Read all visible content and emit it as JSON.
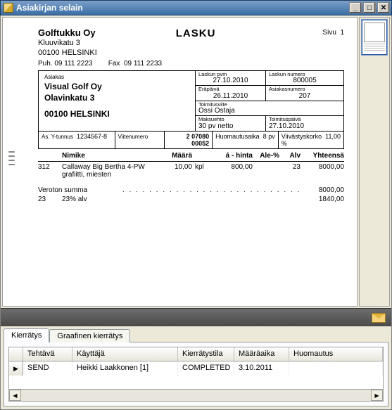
{
  "window": {
    "title": "Asiakirjan selain"
  },
  "invoice": {
    "company": {
      "name": "Golftukku Oy",
      "street": "Kluuvikatu 3",
      "city": "00100 HELSINKI",
      "phone_lbl": "Puh.",
      "phone": "09 111 2223",
      "fax_lbl": "Fax",
      "fax": "09 111 2233"
    },
    "doc_title": "LASKU",
    "page_lbl": "Sivu",
    "page_no": "1",
    "customer_lbl": "Asiakas",
    "customer": {
      "name": "Visual Golf Oy",
      "street": "Olavinkatu 3",
      "city": "00100 HELSINKI"
    },
    "info": {
      "laskun_pvm_lbl": "Laskun pvm",
      "laskun_pvm": "27.10.2010",
      "laskun_numero_lbl": "Laskun numero",
      "laskun_numero": "800005",
      "erapaiva_lbl": "Eräpäivä",
      "erapaiva": "26.11.2010",
      "asiakasnumero_lbl": "Asiakasnumero",
      "asiakasnumero": "207",
      "toimitusviite_lbl": "Toimitusviite",
      "toimitusviite": "Ossi Ostaja",
      "maksuehto_lbl": "Maksuehto",
      "maksuehto": "30 pv netto",
      "toimituspaiva_lbl": "Toimituspäivä",
      "toimituspaiva": "27.10.2010"
    },
    "yt": {
      "ytunnus_lbl": "As. Y-tunnus",
      "ytunnus": "1234567-8",
      "viitenumero_lbl": "Viitenumero",
      "viitenumero": "2 07080 00052",
      "huom_lbl": "Huomautusaika",
      "huom": "8",
      "huom_unit": "pv",
      "viiv_lbl": "Viivästyskorko",
      "viiv": "11,00 %"
    },
    "cols": {
      "nimike": "Nimike",
      "maara": "Määrä",
      "ahinta": "á - hinta",
      "ale": "Ale-%",
      "alv": "Alv",
      "yhteensa": "Yhteensä"
    },
    "items": [
      {
        "code": "312",
        "name": "Callaway Big Bertha 4-PW grafiitti, miesten",
        "qty": "10,00",
        "unit": "kpl",
        "price": "800,00",
        "ale": "",
        "alv": "23",
        "total": "8000,00"
      }
    ],
    "summary": {
      "veroton_lbl": "Veroton summa",
      "veroton_val": "8000,00",
      "alv_code": "23",
      "alv_pct": "23% alv",
      "alv_val": "1840,00"
    }
  },
  "tabs": {
    "kierratys": "Kierrätys",
    "graafinen": "Graafinen kierrätys"
  },
  "grid": {
    "cols": {
      "tehtava": "Tehtävä",
      "kayttaja": "Käyttäjä",
      "tila": "Kierrätystila",
      "maaraaika": "Määräaika",
      "huomautus": "Huomautus"
    },
    "rows": [
      {
        "tehtava": "SEND",
        "kayttaja": "Heikki Laakkonen [1]",
        "tila": "COMPLETED",
        "maaraaika": "3.10.2011",
        "huomautus": ""
      }
    ]
  }
}
